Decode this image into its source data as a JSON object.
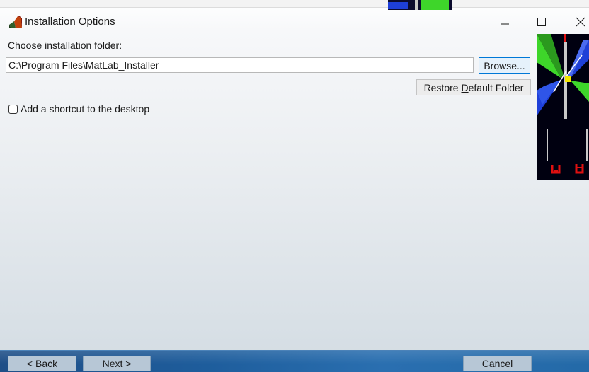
{
  "window": {
    "title": "Installation Options",
    "controls": {
      "minimize": "minimize-icon",
      "maximize": "maximize-icon",
      "close": "close-icon"
    }
  },
  "folder": {
    "label": "Choose installation folder:",
    "path_value": "C:\\Program Files\\MatLab_Installer",
    "browse_label": "Browse...",
    "restore_prefix": "Restore ",
    "restore_underlined": "D",
    "restore_suffix": "efault Folder"
  },
  "shortcut": {
    "label": "Add a shortcut to the desktop",
    "checked": false
  },
  "footer": {
    "back_prefix": "< ",
    "back_underlined": "B",
    "back_suffix": "ack",
    "next_underlined": "N",
    "next_suffix": "ext >",
    "cancel_label": "Cancel"
  },
  "colors": {
    "accent": "#0078d7",
    "footer_bar": "#1e5d9c",
    "footer_button": "#b7c7d6",
    "game_green": "#3ed62a",
    "game_blue": "#1e3fd8",
    "game_red": "#e01010"
  }
}
